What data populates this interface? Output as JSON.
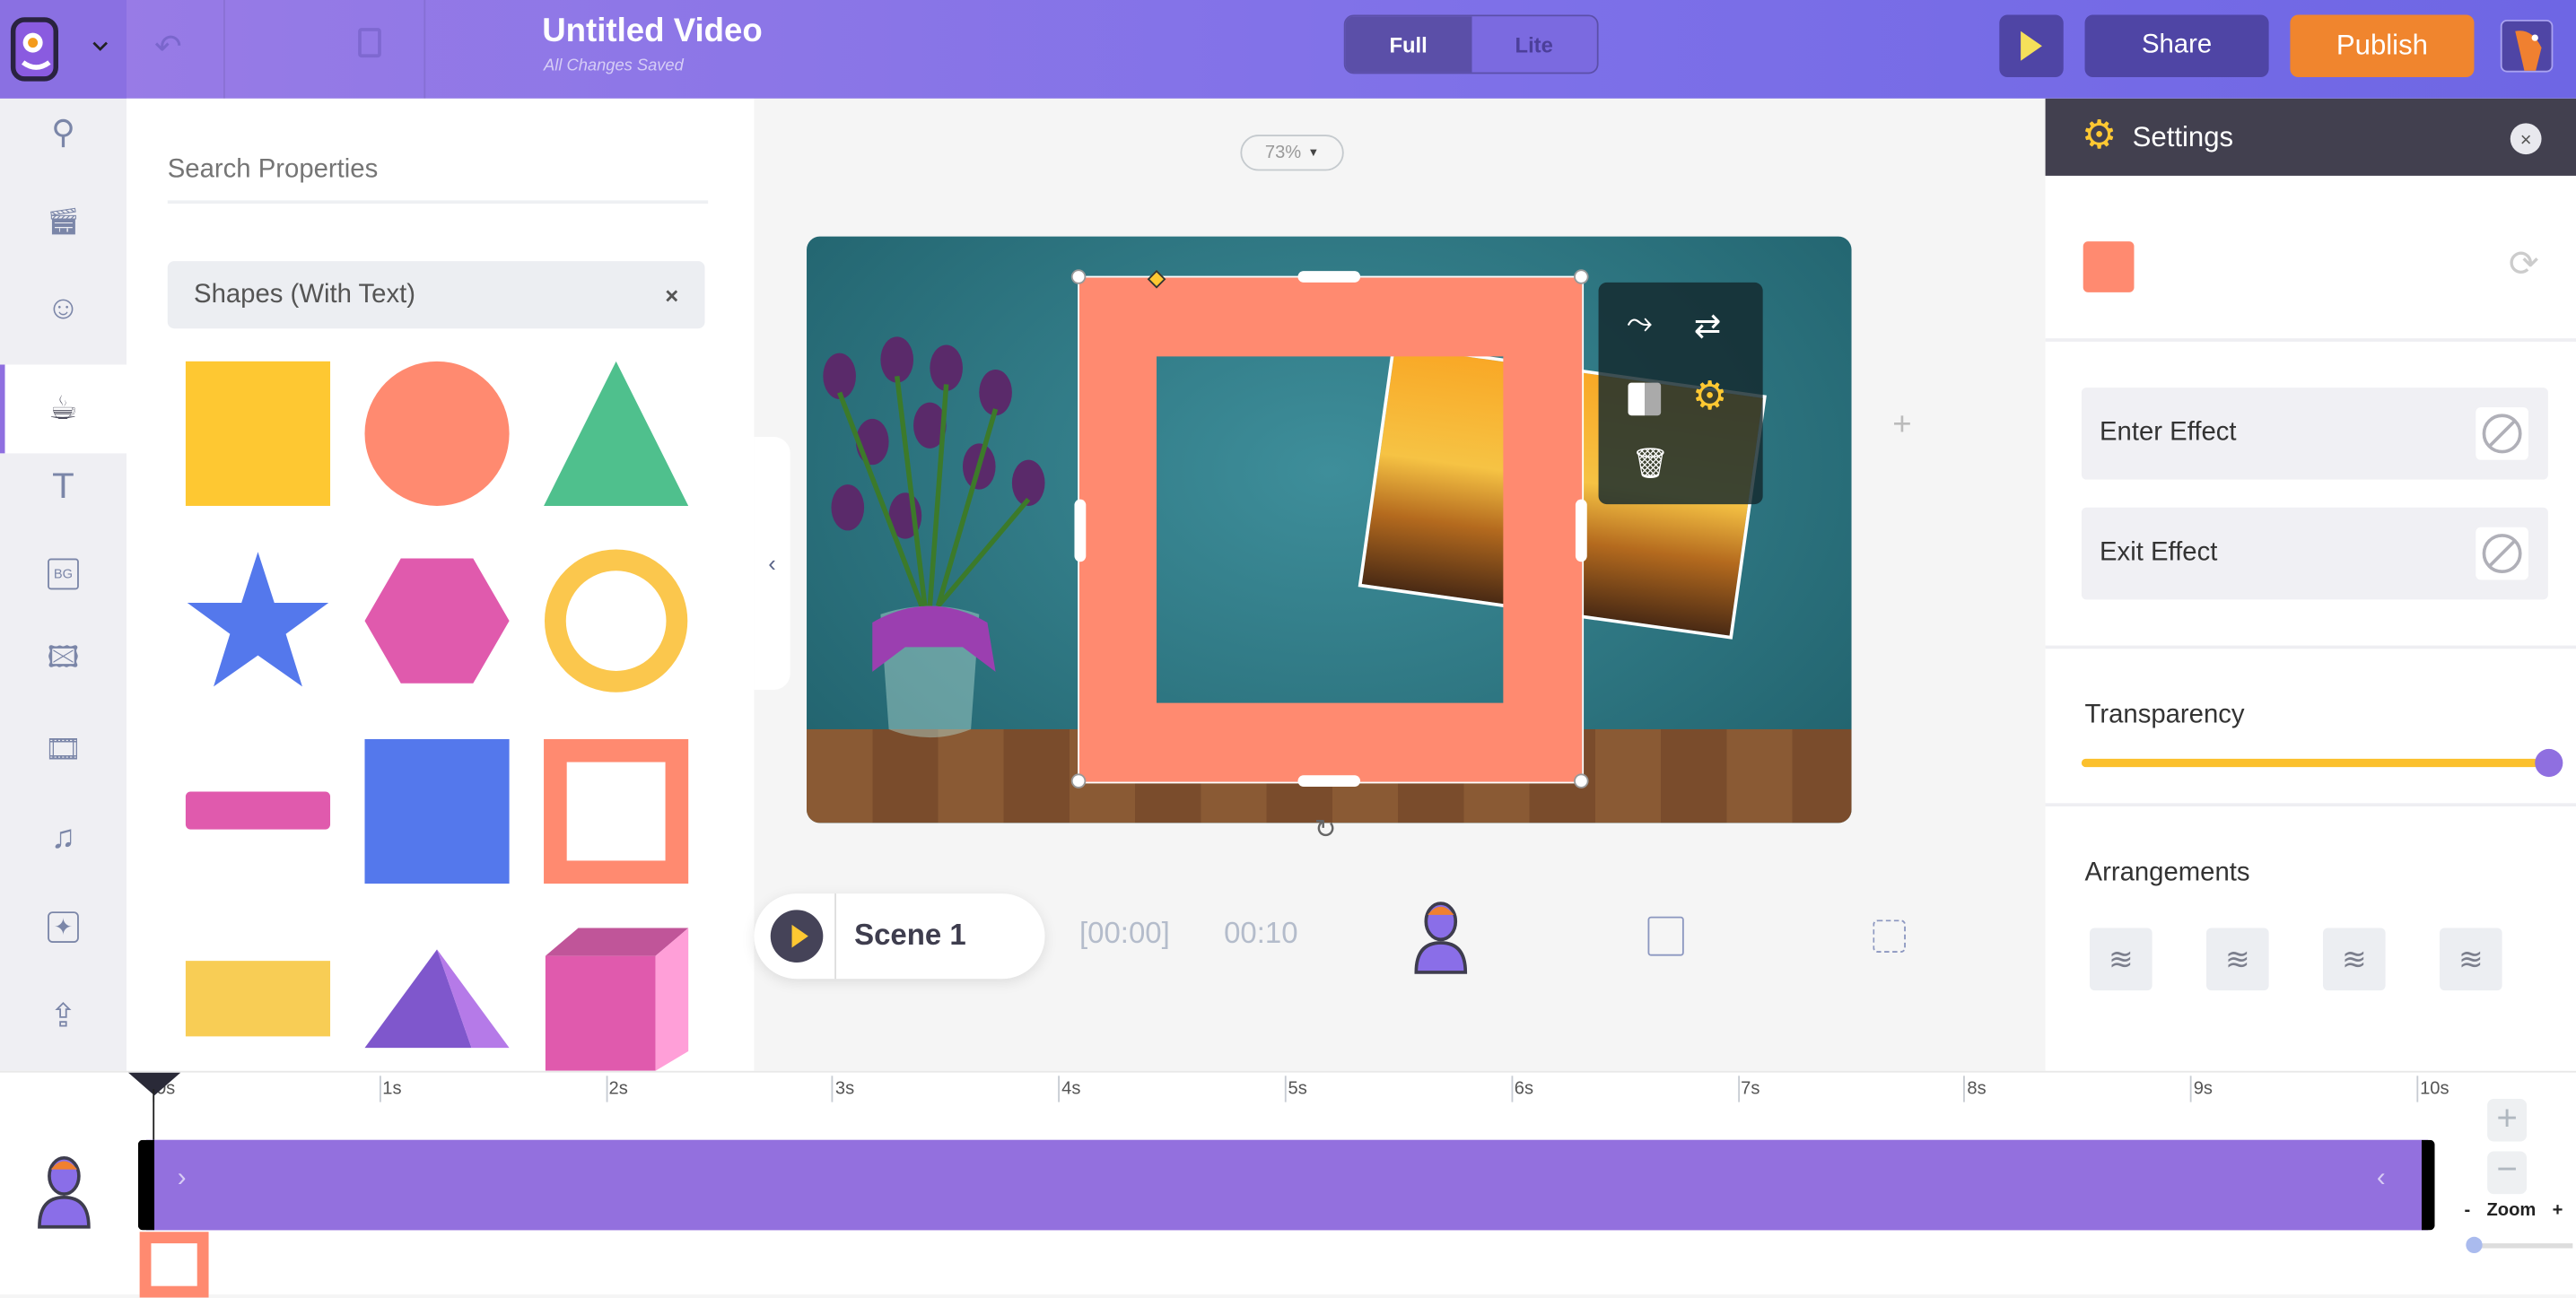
{
  "header": {
    "title": "Untitled Video",
    "status": "All Changes Saved",
    "mode_full": "Full",
    "mode_lite": "Lite",
    "share": "Share",
    "publish": "Publish"
  },
  "colors": {
    "accent": "#8f6fe0",
    "publish": "#f0852e",
    "shape_selected": "#ff8a70",
    "timeline_bar": "#9370de"
  },
  "sidebar": {
    "items": [
      "search-icon",
      "scene-icon",
      "character-icon",
      "props-icon",
      "text-icon",
      "bg-icon",
      "image-icon",
      "video-icon",
      "music-icon",
      "effects-icon",
      "upload-icon"
    ],
    "active": "props-icon"
  },
  "properties": {
    "search_placeholder": "Search Properties",
    "category": "Shapes (With Text)",
    "shapes": [
      "square",
      "circle",
      "triangle",
      "star",
      "hexagon",
      "ring",
      "bar",
      "blue-square",
      "square-frame",
      "rectangle",
      "pyramid",
      "cube"
    ]
  },
  "canvas": {
    "zoom": "73%"
  },
  "scene": {
    "name": "Scene 1",
    "start": "[00:00]",
    "duration": "00:10"
  },
  "settings": {
    "title": "Settings",
    "enter_effect": "Enter Effect",
    "exit_effect": "Exit Effect",
    "transparency_label": "Transparency",
    "transparency_value": 100,
    "arrangements_label": "Arrangements"
  },
  "timeline": {
    "ticks": [
      "0s",
      "1s",
      "2s",
      "3s",
      "4s",
      "5s",
      "6s",
      "7s",
      "8s",
      "9s",
      "10s"
    ],
    "zoom_label": "Zoom",
    "zoom_minus": "-",
    "zoom_plus": "+"
  }
}
